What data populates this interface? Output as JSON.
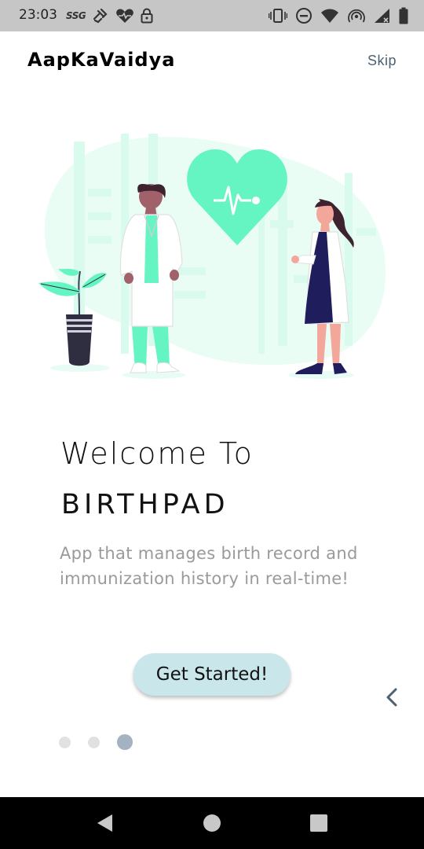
{
  "status_bar": {
    "time": "23:03",
    "carrier_tag": "SSG",
    "left_icons": [
      "ssg-icon",
      "link-icon",
      "heart-icon",
      "lock-icon"
    ],
    "right_icons": [
      "vibrate-icon",
      "dnd-icon",
      "wifi-icon",
      "hotspot-icon",
      "signal-icon",
      "battery-icon"
    ]
  },
  "header": {
    "brand": "AapKaVaidya",
    "skip_label": "Skip"
  },
  "illustration": {
    "icon": "doctors-heart-illustration",
    "colors": {
      "accent": "#64f5c2",
      "accent_light": "#e9fdf5",
      "skin": "#f3a79a",
      "hair": "#3f2230",
      "dark": "#2f2e41",
      "navy": "#1f1d5c"
    }
  },
  "onboarding": {
    "title": "Welcome To",
    "app_name": "BIRTHPAD",
    "description": "App that manages birth record and immunization history in real-time!",
    "cta_label": "Get Started!",
    "back_icon": "chevron-left-icon"
  },
  "pager": {
    "count": 3,
    "active_index": 2
  },
  "nav_bar": {
    "buttons": [
      "back-triangle-icon",
      "home-circle-icon",
      "recents-square-icon"
    ]
  },
  "colors": {
    "status_bar_bg": "#c6c6c6",
    "cta_bg": "#c9e6ea",
    "skip_text": "#4d6170",
    "description_text": "#9a9a9a",
    "dot_inactive": "#dfe1e3",
    "dot_active": "#a4b3c2",
    "back_arrow": "#4d6170"
  }
}
